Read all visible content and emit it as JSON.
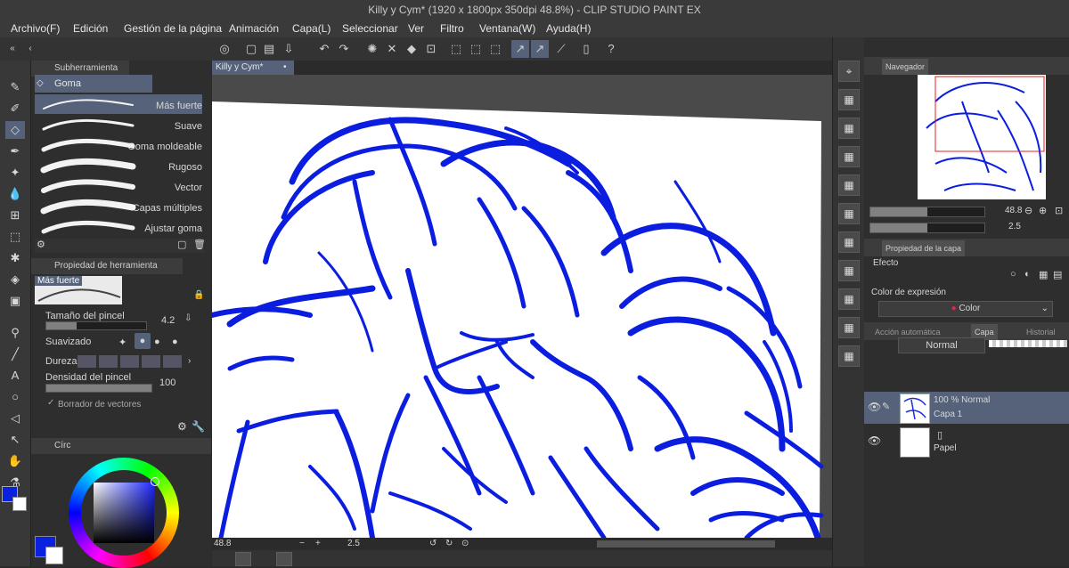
{
  "window": {
    "title": "Killy y Cym* (1920 x 1800px 350dpi 48.8%) - CLIP STUDIO PAINT EX"
  },
  "menu": [
    "Archivo(F)",
    "Edición",
    "Gestión de la página",
    "Animación",
    "Capa(L)",
    "Seleccionar",
    "Ver",
    "Filtro",
    "Ventana(W)",
    "Ayuda(H)"
  ],
  "subtool": {
    "header": "Subherramienta",
    "group": "Goma",
    "brushes": [
      "Más fuerte",
      "Suave",
      "Goma moldeable",
      "Rugoso",
      "Vector",
      "Capas múltiples",
      "Ajustar goma"
    ],
    "selected_index": 0
  },
  "tool_property": {
    "header": "Propiedad de herramienta",
    "preset": "Más fuerte",
    "brush_size_label": "Tamaño del pincel",
    "brush_size_value": "4.2",
    "brush_size_fraction": 0.3,
    "smoothing_label": "Suavizado",
    "hardness_label": "Dureza",
    "density_label": "Densidad del pincel",
    "density_value": "100",
    "density_fraction": 1.0,
    "vector_eraser_label": "Borrador de vectores"
  },
  "color_panel": {
    "tab": "Círc",
    "main_color": "#0a22e0",
    "sub_color": "#ffffff"
  },
  "canvas": {
    "tab": "Killy y Cym*",
    "zoom": "48.8",
    "rotation": "2.5",
    "stroke_color": "#0b1ee0"
  },
  "navigator": {
    "header": "Navegador",
    "zoom": "48.8",
    "rotation": "2.5"
  },
  "layer_property": {
    "header": "Propiedad de la capa",
    "effect_label": "Efecto",
    "expression_label": "Color de expresión",
    "expression_value": "Color"
  },
  "layers": {
    "tabs": [
      "Acción automática",
      "Capa",
      "Historial"
    ],
    "blend_mode": "Normal",
    "items": [
      {
        "mode": "100 % Normal",
        "name": "Capa 1"
      },
      {
        "mode": "",
        "name": "Papel"
      }
    ]
  }
}
